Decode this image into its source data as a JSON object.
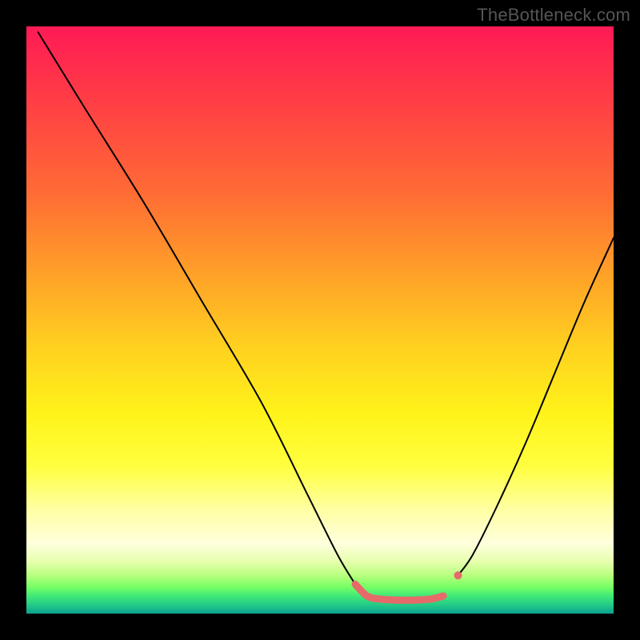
{
  "watermark": "TheBottleneck.com",
  "chart_data": {
    "type": "line",
    "title": "",
    "xlabel": "",
    "ylabel": "",
    "xlim": [
      0,
      100
    ],
    "ylim": [
      0,
      100
    ],
    "grid": false,
    "legend": false,
    "series": [
      {
        "name": "left-curve",
        "color": "#000000",
        "x": [
          2,
          10,
          20,
          30,
          40,
          48,
          53,
          56
        ],
        "y": [
          99,
          86,
          70,
          53,
          36,
          20,
          10,
          5
        ]
      },
      {
        "name": "valley-accent",
        "color": "#e66a6a",
        "x": [
          56,
          58,
          60,
          63,
          66,
          69,
          71,
          72.5,
          73.5
        ],
        "y": [
          5,
          3,
          2.5,
          2.3,
          2.3,
          2.5,
          3,
          4.5,
          6.5
        ]
      },
      {
        "name": "right-curve",
        "color": "#000000",
        "x": [
          73.5,
          76,
          80,
          85,
          90,
          95,
          100
        ],
        "y": [
          6.5,
          10,
          18,
          29,
          41,
          53,
          64
        ]
      }
    ],
    "annotations": []
  }
}
